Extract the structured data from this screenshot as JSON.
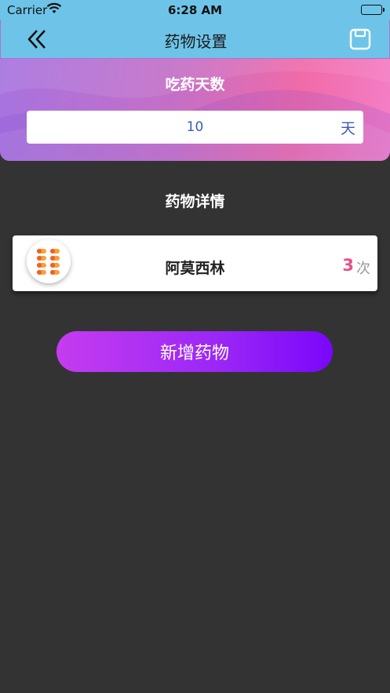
{
  "status_bar": {
    "carrier": "Carrier",
    "time": "6:28 AM"
  },
  "nav": {
    "title": "药物设置",
    "back_icon": "double-chevron-left-icon",
    "save_icon": "floppy-save-icon"
  },
  "days": {
    "label": "吃药天数",
    "value": "10",
    "unit": "天"
  },
  "details": {
    "title": "药物详情",
    "medications": [
      {
        "name": "阿莫西林",
        "count": "3",
        "count_unit": "次",
        "icon": "pills-icon"
      }
    ]
  },
  "add_button": {
    "label": "新增药物"
  },
  "colors": {
    "nav_bg": "#6ec4e8",
    "page_bg": "#333333",
    "count_color": "#e8508a",
    "button_gradient": [
      "#c53cf0",
      "#7a06fb"
    ]
  }
}
